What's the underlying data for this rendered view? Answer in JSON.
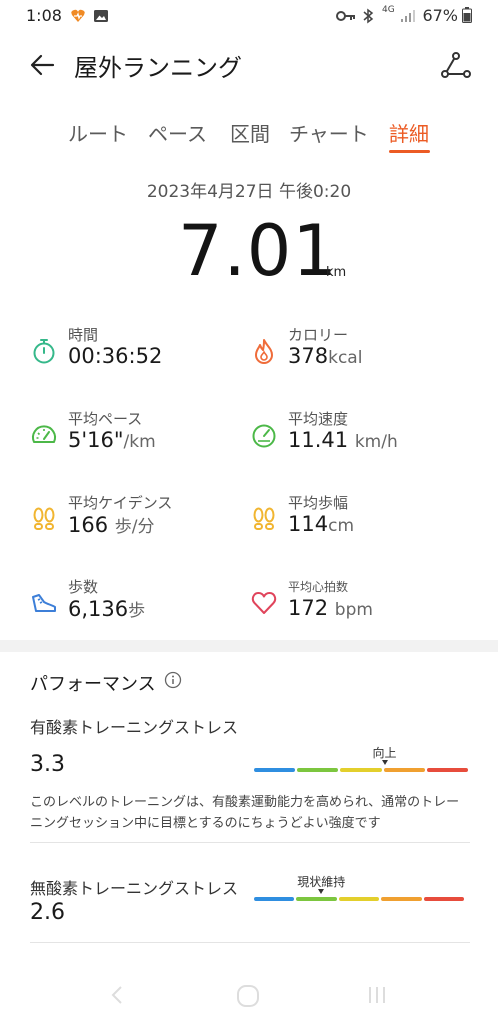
{
  "status_bar": {
    "time": "1:08",
    "network": "4G",
    "battery": "67%"
  },
  "header": {
    "title": "屋外ランニング",
    "back_icon": "arrow-left-icon",
    "route_icon": "route-icon"
  },
  "tabs": [
    {
      "label": "ルート",
      "active": false
    },
    {
      "label": "ペース",
      "active": false
    },
    {
      "label": "区間",
      "active": false
    },
    {
      "label": "チャート",
      "active": false
    },
    {
      "label": "詳細",
      "active": true
    }
  ],
  "summary": {
    "datetime": "2023年4月27日 午後0:20",
    "distance": "7.01",
    "distance_unit": "km"
  },
  "metrics": [
    {
      "label": "時間",
      "value": "00:36:52",
      "unit": "",
      "icon": "stopwatch-icon",
      "color": "#35b88a"
    },
    {
      "label": "カロリー",
      "value": "378",
      "unit": "kcal",
      "icon": "flame-icon",
      "color": "#ef6c3a"
    },
    {
      "label": "平均ペース",
      "value": "5'16\"",
      "unit": "/km",
      "icon": "speedometer-icon",
      "color": "#4cb848"
    },
    {
      "label": "平均速度",
      "value": "11.41",
      "unit": "km/h",
      "icon": "gauge-icon",
      "color": "#4cb848"
    },
    {
      "label": "平均ケイデンス",
      "value": "166",
      "unit": "歩/分",
      "icon": "footprints-icon",
      "color": "#f1b530"
    },
    {
      "label": "平均歩幅",
      "value": "114",
      "unit": "cm",
      "icon": "footprints-icon",
      "color": "#f1b530"
    },
    {
      "label": "歩数",
      "value": "6,136",
      "unit": "歩",
      "icon": "shoe-icon",
      "color": "#3d7fd8"
    },
    {
      "label": "平均心拍数",
      "value": "172",
      "unit": "bpm",
      "icon": "heart-icon",
      "color": "#e0445b"
    }
  ],
  "performance": {
    "title": "パフォーマンス",
    "aerobic": {
      "label": "有酸素トレーニングストレス",
      "value": "3.3",
      "marker": "向上",
      "level": 0.61,
      "description": "このレベルのトレーニングは、有酸素運動能力を高められ、通常のトレーニングセッション中に目標とするのにちょうどよい強度です"
    },
    "anaerobic": {
      "label": "無酸素トレーニングストレス",
      "value": "2.6",
      "marker": "現状維持",
      "level": 0.32
    },
    "bar_colors": [
      "#2f8ee0",
      "#7cc63f",
      "#e3cf2c",
      "#f0a030",
      "#e74c3c"
    ]
  }
}
